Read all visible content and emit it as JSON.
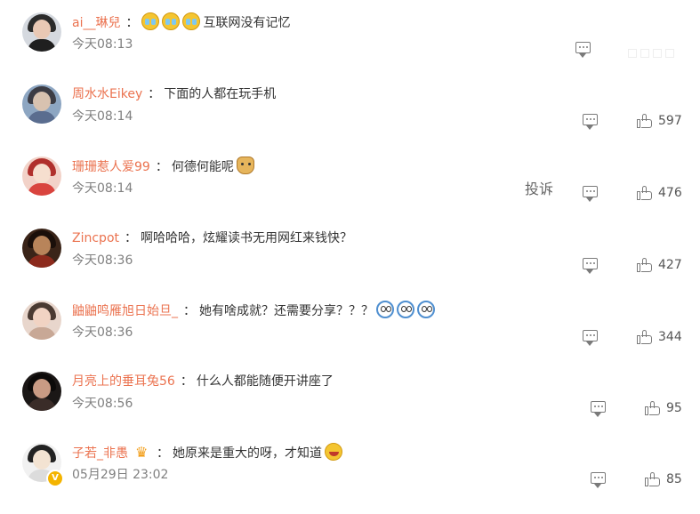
{
  "comments": [
    {
      "username": "ai__琳兒",
      "pre_emojis": [
        "cry-emoji",
        "cry-emoji",
        "cry-emoji"
      ],
      "text": "互联网没有记忆",
      "post_emojis": [],
      "time": "今天08:13",
      "likes": null,
      "avatar_colors": {
        "bg": "#d5d9df",
        "hair": "#2b2b2b",
        "face": "#e9c8b4",
        "body": "#1f1f1f"
      }
    },
    {
      "username": "周水水Eikey",
      "pre_emojis": [],
      "text": "下面的人都在玩手机",
      "post_emojis": [],
      "time": "今天08:14",
      "likes": "597",
      "avatar_colors": {
        "bg": "#8da6c2",
        "hair": "#3c3c44",
        "face": "#d8c2b0",
        "body": "#5a6d8f"
      }
    },
    {
      "username": "珊珊惹人爱99",
      "pre_emojis": [],
      "text": "何德何能呢",
      "post_emojis": [
        "doge-emoji"
      ],
      "time": "今天08:14",
      "likes": "476",
      "report": "投诉",
      "avatar_colors": {
        "bg": "#f2d2c8",
        "hair": "#b0302c",
        "face": "#f6dfcf",
        "body": "#d9443e"
      }
    },
    {
      "username": "Zincpot",
      "pre_emojis": [],
      "text": "啊哈哈哈，炫耀读书无用网红来钱快？",
      "post_emojis": [],
      "time": "今天08:36",
      "likes": "427",
      "avatar_colors": {
        "bg": "#3a2418",
        "hair": "#1a0f0a",
        "face": "#b8845a",
        "body": "#8c2a1c"
      }
    },
    {
      "username": "鼬鼬鸣雁旭日始旦_",
      "pre_emojis": [],
      "text": "她有啥成就？还需要分享？？？",
      "post_emojis": [
        "cat-emoji",
        "cat-emoji",
        "cat-emoji"
      ],
      "time": "今天08:36",
      "likes": "344",
      "avatar_colors": {
        "bg": "#e8d6cc",
        "hair": "#4a3a32",
        "face": "#f1d3c3",
        "body": "#c8a896"
      }
    },
    {
      "username": "月亮上的垂耳兔56",
      "pre_emojis": [],
      "text": "什么人都能随便开讲座了",
      "post_emojis": [],
      "time": "今天08:56",
      "likes": "95",
      "avatar_colors": {
        "bg": "#1b1716",
        "hair": "#0c0a09",
        "face": "#c99b84",
        "body": "#3a2c28"
      }
    },
    {
      "username": "子若_非愚",
      "badge": "crown-icon",
      "pre_emojis": [],
      "text": "她原来是重大的呀，才知道",
      "post_emojis": [
        "laugh-cry-emoji"
      ],
      "time": "05月29日 23:02",
      "likes": "85",
      "verified_badge": "V",
      "avatar_colors": {
        "bg": "#f1f1f1",
        "hair": "#222222",
        "face": "#f3e3d2",
        "body": "#dcdcdc"
      }
    }
  ],
  "colors": {
    "username": "#eb7350",
    "text": "#333333",
    "meta": "#808080",
    "icon": "#7a7a7a"
  }
}
